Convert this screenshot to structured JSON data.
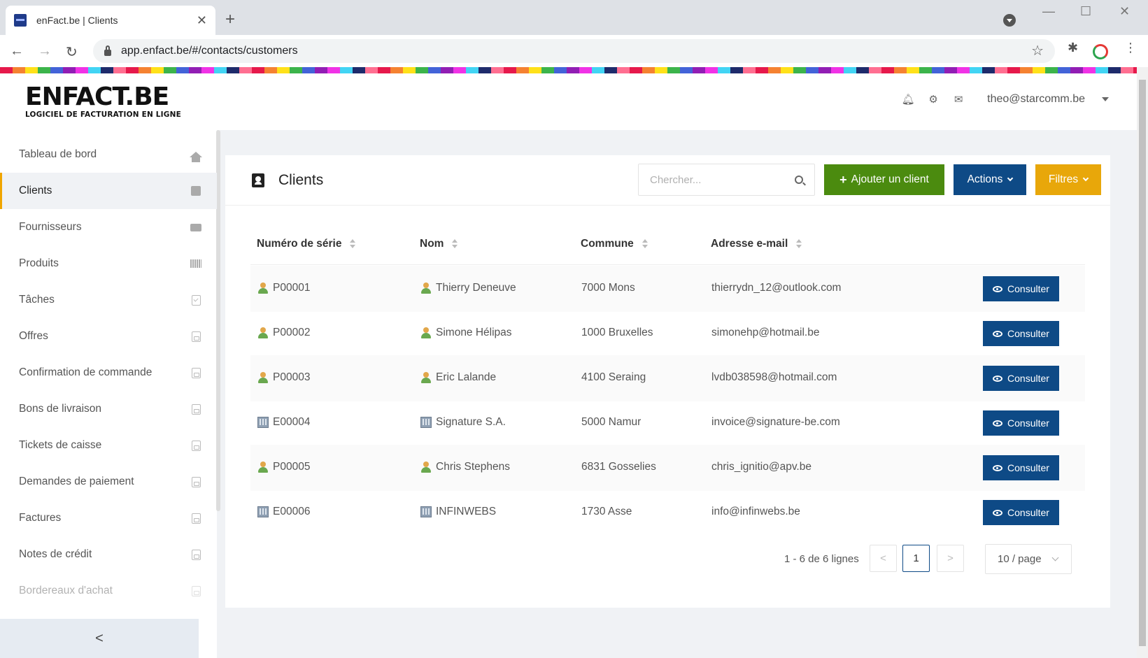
{
  "browser": {
    "tab_title": "enFact.be | Clients",
    "url": "app.enfact.be/#/contacts/customers"
  },
  "header": {
    "logo_main": "ENFACT.BE",
    "logo_sub": "LOGICIEL DE FACTURATION EN LIGNE",
    "user_email": "theo@starcomm.be"
  },
  "sidebar": {
    "items": [
      {
        "label": "Tableau de bord",
        "icon": "home-icon"
      },
      {
        "label": "Clients",
        "icon": "contact-book-icon"
      },
      {
        "label": "Fournisseurs",
        "icon": "truck-icon"
      },
      {
        "label": "Produits",
        "icon": "barcode-icon"
      },
      {
        "label": "Tâches",
        "icon": "clipboard-check-icon"
      },
      {
        "label": "Offres",
        "icon": "pdf-file-icon"
      },
      {
        "label": "Confirmation de commande",
        "icon": "pdf-file-icon"
      },
      {
        "label": "Bons de livraison",
        "icon": "pdf-file-icon"
      },
      {
        "label": "Tickets de caisse",
        "icon": "pdf-file-icon"
      },
      {
        "label": "Demandes de paiement",
        "icon": "pdf-file-icon"
      },
      {
        "label": "Factures",
        "icon": "pdf-file-icon"
      },
      {
        "label": "Notes de crédit",
        "icon": "pdf-file-icon"
      },
      {
        "label": "Bordereaux d'achat",
        "icon": "pdf-file-icon"
      }
    ],
    "active": "Clients",
    "collapse_label": "<"
  },
  "page": {
    "title": "Clients",
    "search_placeholder": "Chercher...",
    "add_button": "Ajouter un client",
    "actions_button": "Actions",
    "filters_button": "Filtres"
  },
  "table": {
    "columns": [
      "Numéro de série",
      "Nom",
      "Commune",
      "Adresse e-mail"
    ],
    "consult_label": "Consulter",
    "rows": [
      {
        "serial": "P00001",
        "name": "Thierry Deneuve",
        "commune": "7000 Mons",
        "email": "thierrydn_12@outlook.com",
        "type": "person"
      },
      {
        "serial": "P00002",
        "name": "Simone Hélipas",
        "commune": "1000 Bruxelles",
        "email": "simonehp@hotmail.be",
        "type": "person"
      },
      {
        "serial": "P00003",
        "name": "Eric Lalande",
        "commune": "4100 Seraing",
        "email": "lvdb038598@hotmail.com",
        "type": "person"
      },
      {
        "serial": "E00004",
        "name": "Signature S.A.",
        "commune": "5000 Namur",
        "email": "invoice@signature-be.com",
        "type": "company"
      },
      {
        "serial": "P00005",
        "name": "Chris Stephens",
        "commune": "6831 Gosselies",
        "email": "chris_ignitio@apv.be",
        "type": "person"
      },
      {
        "serial": "E00006",
        "name": "INFINWEBS",
        "commune": "1730 Asse",
        "email": "info@infinwebs.be",
        "type": "company"
      }
    ]
  },
  "pagination": {
    "total": "1 - 6 de 6 lignes",
    "current_page": "1",
    "page_size": "10 / page",
    "prev": "<",
    "next": ">"
  },
  "colors": {
    "primary": "#0e4a86",
    "success": "#4b8b0f",
    "warning": "#e8a70a"
  }
}
